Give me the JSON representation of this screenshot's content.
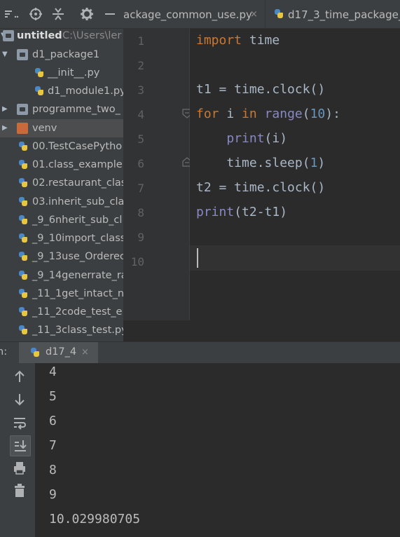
{
  "project": {
    "toolbar_icons": [
      "sort-icon",
      "locate-icon",
      "collapse-all-icon",
      "settings-icon",
      "hide-icon"
    ],
    "root": {
      "label": "untitled",
      "path": "C:\\Users\\ler"
    },
    "items": [
      {
        "label": "d1_package1",
        "type": "folder",
        "expanded": true
      },
      {
        "label": "__init__.py",
        "type": "python"
      },
      {
        "label": "d1_module1.py",
        "type": "python"
      },
      {
        "label": "programme_two_",
        "type": "folder",
        "expanded": false
      },
      {
        "label": "venv",
        "type": "folder-venv",
        "expanded": false
      },
      {
        "label": "00.TestCasePytho",
        "type": "python"
      },
      {
        "label": "01.class_example.",
        "type": "python"
      },
      {
        "label": "02.restaurant_clas",
        "type": "python"
      },
      {
        "label": "03.inherit_sub_cla",
        "type": "python"
      },
      {
        "label": "_9_6nherit_sub_cl",
        "type": "python"
      },
      {
        "label": "_9_10import_class",
        "type": "python"
      },
      {
        "label": "_9_13use_Orderec",
        "type": "python"
      },
      {
        "label": "_9_14generrate_ra",
        "type": "python"
      },
      {
        "label": "_11_1get_intact_n",
        "type": "python"
      },
      {
        "label": "_11_2code_test_e",
        "type": "python"
      },
      {
        "label": "_11_3class_test.py",
        "type": "python"
      }
    ]
  },
  "editor": {
    "tabs": [
      {
        "label": "ackage_common_use.py",
        "close": "×"
      },
      {
        "label": "d17_3_time_package_",
        "close": ""
      }
    ],
    "line_numbers": [
      "1",
      "2",
      "3",
      "4",
      "5",
      "6",
      "7",
      "8",
      "9",
      "10"
    ],
    "code": {
      "l1_kw": "import",
      "l1_rest": " time",
      "l3": "t1 = time.clock()",
      "l4_kw1": "for",
      "l4_a": " i ",
      "l4_kw2": "in",
      "l4_sp": " ",
      "l4_bi": "range",
      "l4_p1": "(",
      "l4_num": "10",
      "l4_p2": "):",
      "l5_ind": "    ",
      "l5_bi": "print",
      "l5_rest": "(i)",
      "l6_a": "    time.sleep(",
      "l6_num": "1",
      "l6_b": ")",
      "l7": "t2 = time.clock()",
      "l8_bi": "print",
      "l8_rest": "(t2-t1)"
    }
  },
  "run": {
    "label": "n:",
    "tab_label": "d17_4",
    "tab_close": "×",
    "sidebar_icons": [
      "rerun-up-icon",
      "down-arrow-icon",
      "soft-wrap-icon",
      "scroll-to-end-icon",
      "print-icon",
      "trash-icon"
    ],
    "output": [
      "4",
      "5",
      "6",
      "7",
      "8",
      "9",
      "10.029980705"
    ]
  }
}
